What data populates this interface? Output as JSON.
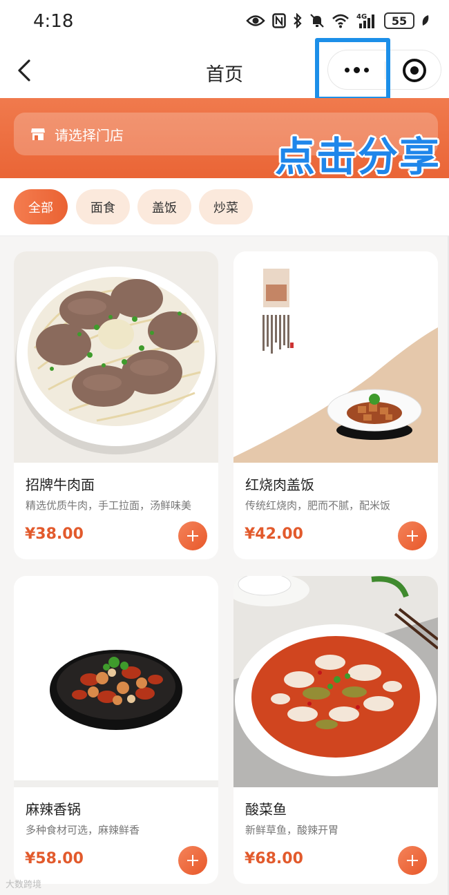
{
  "status_bar": {
    "time": "4:18",
    "battery": "55",
    "network": "4G",
    "icons": [
      "eye-icon",
      "nfc-icon",
      "bluetooth-icon",
      "mute-icon",
      "wifi-icon",
      "signal-icon",
      "battery-icon",
      "leaf-icon"
    ]
  },
  "nav": {
    "title": "首页",
    "more_icon": "more-dots-icon",
    "close_icon": "record-circle-icon"
  },
  "banner": {
    "store_placeholder": "请选择门店",
    "share_hint": "点击分享"
  },
  "categories": [
    {
      "label": "全部",
      "active": true
    },
    {
      "label": "面食",
      "active": false
    },
    {
      "label": "盖饭",
      "active": false
    },
    {
      "label": "炒菜",
      "active": false
    }
  ],
  "products": [
    {
      "name": "招牌牛肉面",
      "desc": "精选优质牛肉，手工拉面，汤鲜味美",
      "price": "¥38.00"
    },
    {
      "name": "红烧肉盖饭",
      "desc": "传统红烧肉，肥而不腻，配米饭",
      "price": "¥42.00"
    },
    {
      "name": "麻辣香锅",
      "desc": "多种食材可选，麻辣鲜香",
      "price": "¥58.00"
    },
    {
      "name": "酸菜鱼",
      "desc": "新鲜草鱼，酸辣开胃",
      "price": "¥68.00"
    }
  ],
  "watermark": "大数跨境",
  "colors": {
    "accent": "#ea6536",
    "price": "#e25a2c",
    "highlight": "#1c8fe8",
    "tab_inactive": "#fbe9dc"
  }
}
